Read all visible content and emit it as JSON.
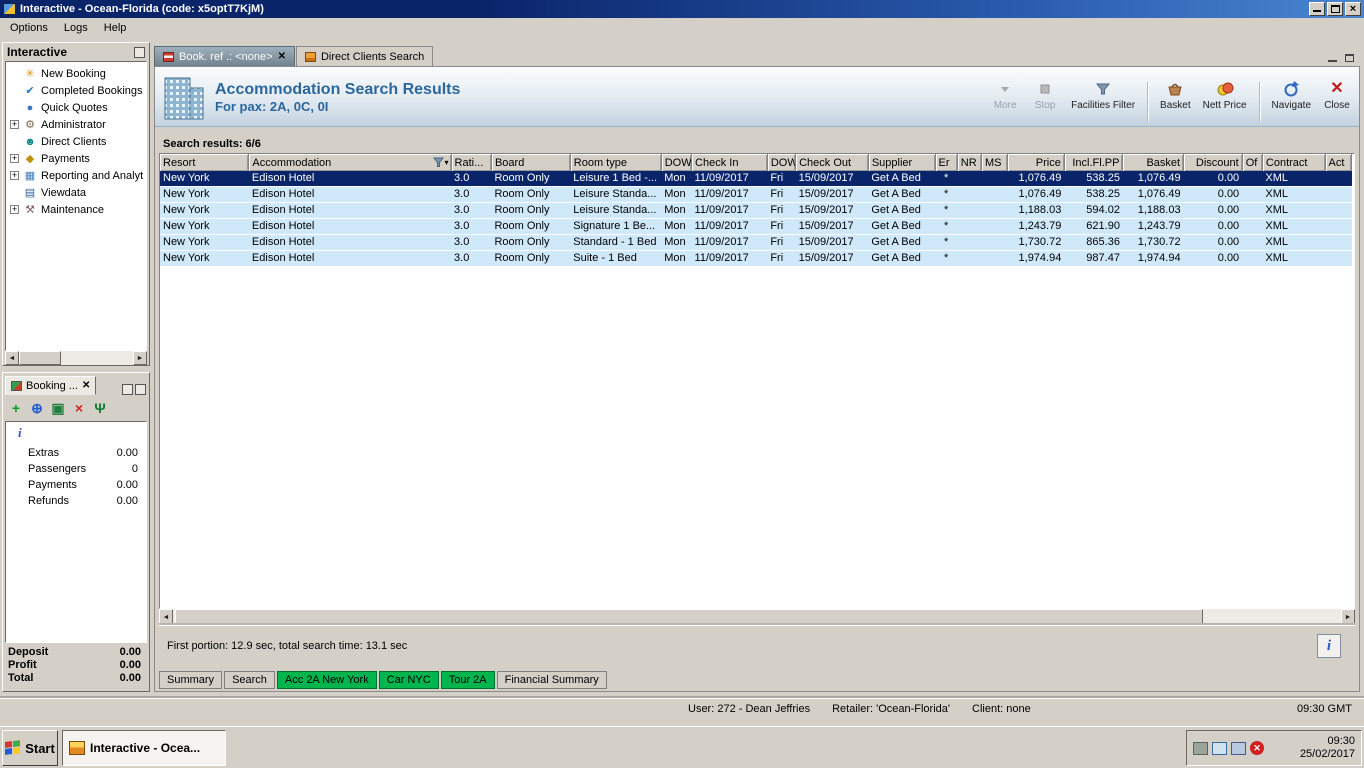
{
  "window": {
    "title": "Interactive - Ocean-Florida (code: x5optT7KjM)",
    "menu": [
      "Options",
      "Logs",
      "Help"
    ]
  },
  "sidebar": {
    "title": "Interactive",
    "items": [
      {
        "label": "New Booking",
        "icon": "new-booking",
        "expandable": false
      },
      {
        "label": "Completed Bookings",
        "icon": "completed-bookings",
        "expandable": false
      },
      {
        "label": "Quick Quotes",
        "icon": "quick-quotes",
        "expandable": false
      },
      {
        "label": "Administrator",
        "icon": "administrator",
        "expandable": true
      },
      {
        "label": "Direct Clients",
        "icon": "direct-clients",
        "expandable": false
      },
      {
        "label": "Payments",
        "icon": "payments",
        "expandable": true
      },
      {
        "label": "Reporting and Analyt",
        "icon": "reporting",
        "expandable": true
      },
      {
        "label": "Viewdata",
        "icon": "viewdata",
        "expandable": false
      },
      {
        "label": "Maintenance",
        "icon": "maintenance",
        "expandable": true
      }
    ]
  },
  "booking_panel": {
    "tab_label": "Booking ...",
    "info_icon": "i",
    "toolbar_icons": [
      "add",
      "globe",
      "cascade",
      "delete",
      "palm-tree"
    ],
    "info_rows": [
      {
        "label": "Extras",
        "value": "0.00"
      },
      {
        "label": "Passengers",
        "value": "0"
      },
      {
        "label": "Payments",
        "value": "0.00"
      },
      {
        "label": "Refunds",
        "value": "0.00"
      }
    ],
    "summary_rows": [
      {
        "label": "Deposit",
        "value": "0.00"
      },
      {
        "label": "Profit",
        "value": "0.00"
      },
      {
        "label": "Total",
        "value": "0.00"
      }
    ]
  },
  "tabs": [
    {
      "label": "Book. ref .: <none>",
      "active": true,
      "closable": true
    },
    {
      "label": "Direct Clients Search",
      "active": false,
      "closable": false
    }
  ],
  "results_header": {
    "title": "Accommodation Search Results",
    "subtitle": "For pax: 2A, 0C, 0I",
    "buttons": [
      {
        "label": "More",
        "icon": "more-arrow-icon",
        "disabled": true
      },
      {
        "label": "Stop",
        "icon": "stop-icon",
        "disabled": true
      },
      {
        "label": "Facilities Filter",
        "icon": "filter-funnel-icon",
        "disabled": false
      },
      {
        "label": "Basket",
        "icon": "basket-icon",
        "disabled": false
      },
      {
        "label": "Nett Price",
        "icon": "coins-icon",
        "disabled": false
      },
      {
        "label": "Navigate",
        "icon": "navigate-icon",
        "disabled": false
      },
      {
        "label": "Close",
        "icon": "close-icon",
        "disabled": false
      }
    ]
  },
  "results": {
    "count_label": "Search results: 6/6",
    "info_button": "i",
    "selected_index": 0,
    "columns": [
      "Resort",
      "Accommodation",
      "Rati...",
      "Board",
      "Room type",
      "DOW",
      "Check In",
      "DOW",
      "Check Out",
      "Supplier",
      "Er",
      "NR",
      "MS",
      "Price",
      "Incl.Fl.PP",
      "Basket",
      "Discount",
      "Of",
      "Contract",
      "Act"
    ],
    "rows": [
      [
        "New York",
        "Edison Hotel",
        "3.0",
        "Room Only",
        "Leisure 1 Bed -...",
        "Mon",
        "11/09/2017",
        "Fri",
        "15/09/2017",
        "Get A Bed",
        "*",
        "",
        "",
        "1,076.49",
        "538.25",
        "1,076.49",
        "0.00",
        "",
        "XML",
        ""
      ],
      [
        "New York",
        "Edison Hotel",
        "3.0",
        "Room Only",
        "Leisure Standa...",
        "Mon",
        "11/09/2017",
        "Fri",
        "15/09/2017",
        "Get A Bed",
        "*",
        "",
        "",
        "1,076.49",
        "538.25",
        "1,076.49",
        "0.00",
        "",
        "XML",
        ""
      ],
      [
        "New York",
        "Edison Hotel",
        "3.0",
        "Room Only",
        "Leisure Standa...",
        "Mon",
        "11/09/2017",
        "Fri",
        "15/09/2017",
        "Get A Bed",
        "*",
        "",
        "",
        "1,188.03",
        "594.02",
        "1,188.03",
        "0.00",
        "",
        "XML",
        ""
      ],
      [
        "New York",
        "Edison Hotel",
        "3.0",
        "Room Only",
        "Signature 1 Be...",
        "Mon",
        "11/09/2017",
        "Fri",
        "15/09/2017",
        "Get A Bed",
        "*",
        "",
        "",
        "1,243.79",
        "621.90",
        "1,243.79",
        "0.00",
        "",
        "XML",
        ""
      ],
      [
        "New York",
        "Edison Hotel",
        "3.0",
        "Room Only",
        "Standard - 1 Bed",
        "Mon",
        "11/09/2017",
        "Fri",
        "15/09/2017",
        "Get A Bed",
        "*",
        "",
        "",
        "1,730.72",
        "865.36",
        "1,730.72",
        "0.00",
        "",
        "XML",
        ""
      ],
      [
        "New York",
        "Edison Hotel",
        "3.0",
        "Room Only",
        "Suite - 1 Bed",
        "Mon",
        "11/09/2017",
        "Fri",
        "15/09/2017",
        "Get A Bed",
        "*",
        "",
        "",
        "1,974.94",
        "987.47",
        "1,974.94",
        "0.00",
        "",
        "XML",
        ""
      ]
    ],
    "status": "First portion: 12.9 sec, total search time: 13.1 sec"
  },
  "bottom_tabs": [
    {
      "label": "Summary",
      "green": false
    },
    {
      "label": "Search",
      "green": false
    },
    {
      "label": "Acc 2A New York",
      "green": true
    },
    {
      "label": "Car NYC",
      "green": true
    },
    {
      "label": "Tour 2A",
      "green": true
    },
    {
      "label": "Financial Summary",
      "green": false
    }
  ],
  "status_bar": {
    "user": "User: 272 - Dean Jeffries",
    "retailer": "Retailer: 'Ocean-Florida'",
    "client": "Client: none",
    "time": "09:30 GMT"
  },
  "taskbar": {
    "start_label": "Start",
    "task_label": "Interactive - Ocea...",
    "clock_time": "09:30",
    "clock_date": "25/02/2017"
  },
  "colors": {
    "selected_row": "#0a246a",
    "row_blue": "#cfe9fb",
    "green_tab": "#00b44e",
    "header_text": "#2b679c"
  }
}
